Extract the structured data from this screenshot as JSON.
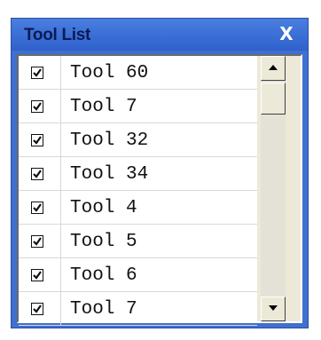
{
  "window": {
    "title": "Tool List",
    "close_label": "X"
  },
  "tools": [
    {
      "label": "Tool 60",
      "checked": true
    },
    {
      "label": "Tool 7",
      "checked": true
    },
    {
      "label": "Tool 32",
      "checked": true
    },
    {
      "label": "Tool 34",
      "checked": true
    },
    {
      "label": "Tool 4",
      "checked": true
    },
    {
      "label": "Tool 5",
      "checked": true
    },
    {
      "label": "Tool 6",
      "checked": true
    },
    {
      "label": "Tool 7",
      "checked": true
    }
  ],
  "scrollbar": {
    "up_icon": "arrow-up-icon",
    "down_icon": "arrow-down-icon",
    "position": 0
  },
  "colors": {
    "titlebar": "#3f6fd1",
    "title_text": "#0a1a55",
    "list_bg": "#ffffff"
  }
}
